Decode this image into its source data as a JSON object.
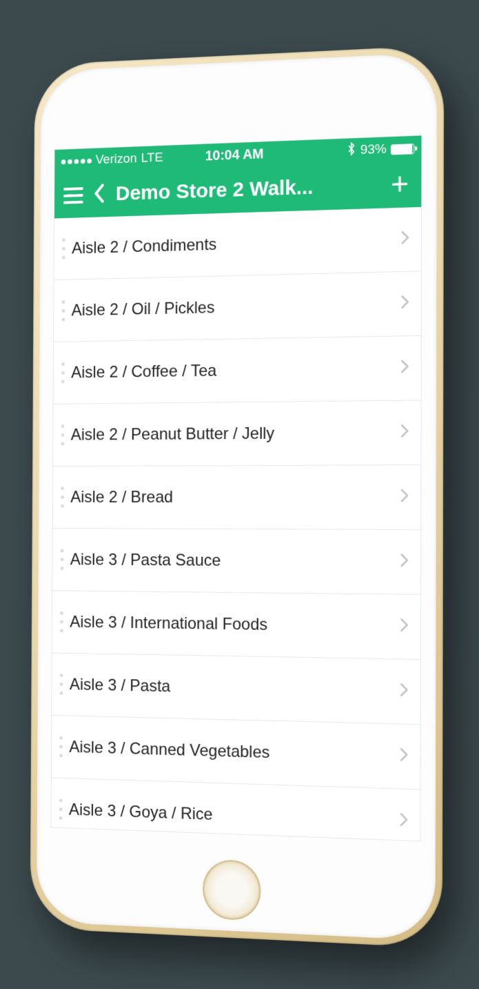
{
  "colors": {
    "accent": "#1fb978"
  },
  "status": {
    "carrier": "Verizon",
    "network": "LTE",
    "time": "10:04 AM",
    "battery_pct": "93%"
  },
  "nav": {
    "title": "Demo Store 2 Walk..."
  },
  "list": {
    "items": [
      {
        "label": "Aisle 2 / Condiments"
      },
      {
        "label": "Aisle 2 / Oil / Pickles"
      },
      {
        "label": "Aisle 2 / Coffee / Tea"
      },
      {
        "label": "Aisle 2 / Peanut Butter / Jelly"
      },
      {
        "label": "Aisle 2 / Bread"
      },
      {
        "label": "Aisle 3 / Pasta Sauce"
      },
      {
        "label": "Aisle 3 / International Foods"
      },
      {
        "label": "Aisle 3 / Pasta"
      },
      {
        "label": "Aisle 3 / Canned Vegetables"
      },
      {
        "label": "Aisle 3 / Goya / Rice"
      }
    ]
  }
}
